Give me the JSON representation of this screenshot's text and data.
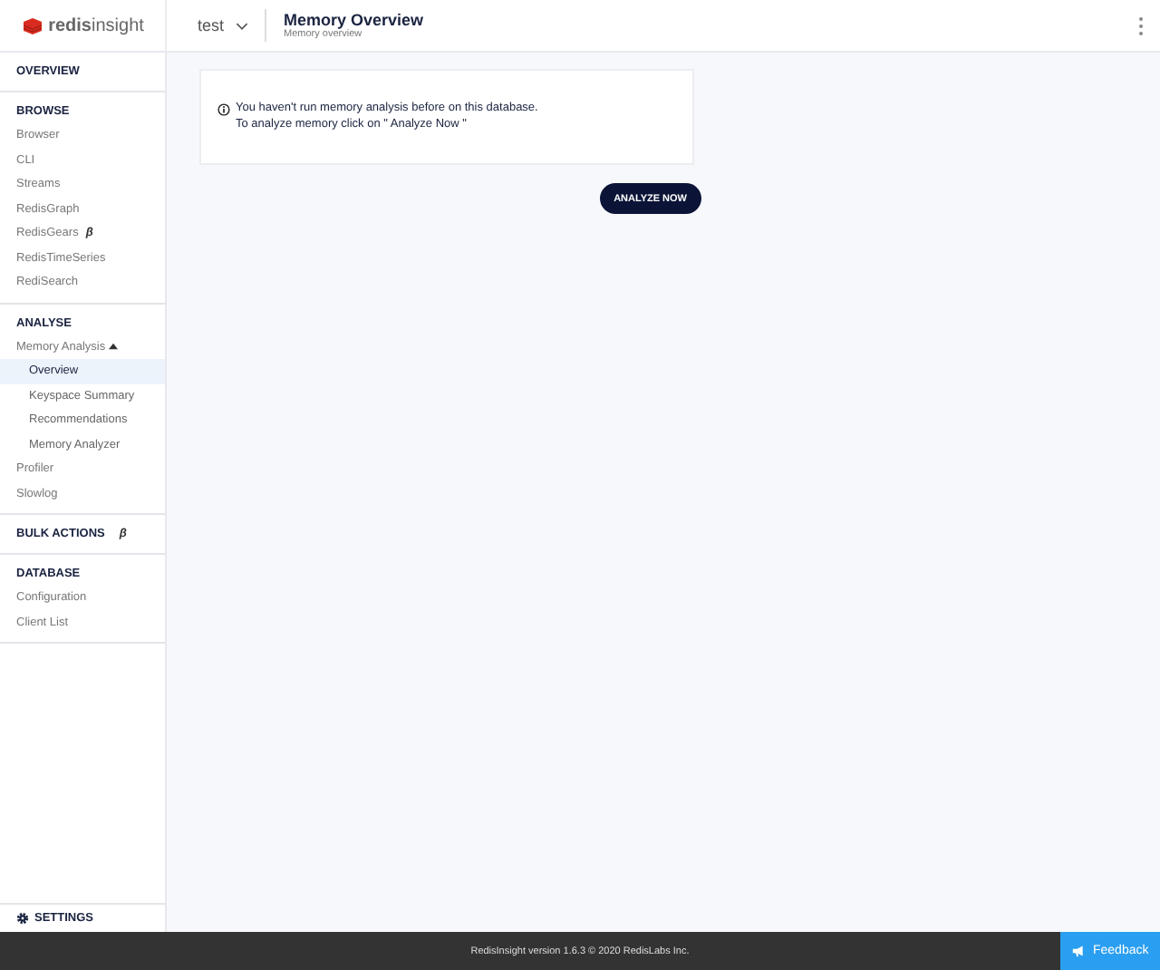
{
  "header": {
    "logo": "**redis**insight",
    "database": "test",
    "title": "Memory Overview",
    "subtitle": "Memory overview"
  },
  "sidebar": {
    "sections": [
      {
        "heading": "OVERVIEW"
      },
      {
        "heading": "BROWSE",
        "items": [
          {
            "label": "Browser",
            "selected": false
          },
          {
            "label": "CLI",
            "selected": false
          },
          {
            "label": "Streams",
            "selected": false
          },
          {
            "label": "RedisGraph",
            "selected": false
          },
          {
            "label": "RedisGears",
            "beta": "β",
            "selected": false
          },
          {
            "label": "RedisTimeSeries",
            "selected": false
          },
          {
            "label": "RediSearch",
            "selected": false
          }
        ]
      },
      {
        "heading": "ANALYSE",
        "items": [
          {
            "label": "Memory Analysis",
            "selected": false,
            "expanded": true,
            "children": [
              {
                "label": "Overview",
                "selected": true
              },
              {
                "label": "Keyspace Summary",
                "selected": false
              },
              {
                "label": "Recommendations",
                "selected": false
              },
              {
                "label": "Memory Analyzer",
                "selected": false
              }
            ]
          },
          {
            "label": "Profiler",
            "selected": false
          },
          {
            "label": "Slowlog",
            "selected": false
          }
        ]
      },
      {
        "heading": "BULK ACTIONS",
        "beta": "β"
      },
      {
        "heading": "DATABASE",
        "items": [
          {
            "label": "Configuration",
            "selected": false
          },
          {
            "label": "Client List",
            "selected": false
          }
        ]
      }
    ],
    "settings": "SETTINGS"
  },
  "notice": {
    "lines": [
      "You haven't run memory analysis before on this database.",
      "To analyze memory click on \" Analyze Now \""
    ]
  },
  "analyze_button": "ANALYZE NOW",
  "footer": {
    "version": "RedisInsight version 1.6.3 © 2020 RedisLabs Inc.",
    "feedback": "Feedback"
  }
}
